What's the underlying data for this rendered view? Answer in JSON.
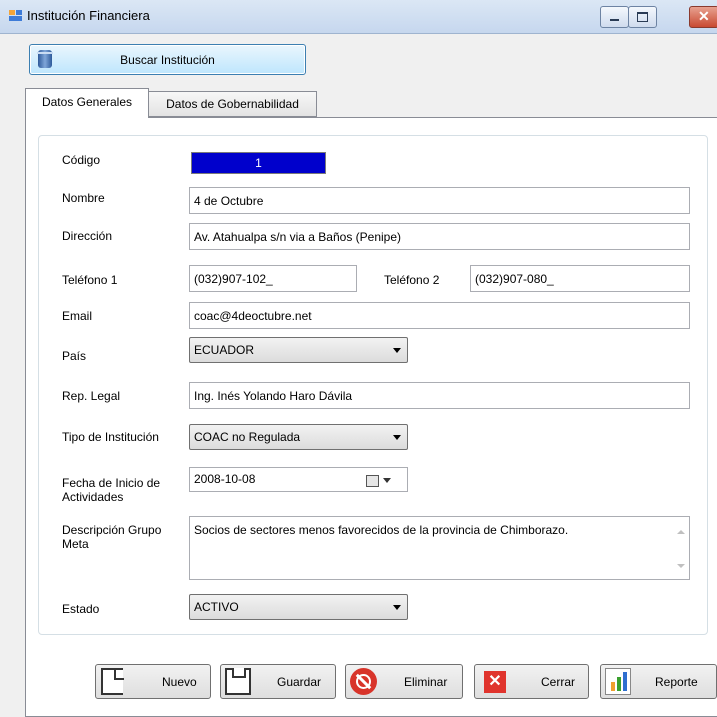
{
  "window": {
    "title": "Institución Financiera"
  },
  "toolbar": {
    "search_label": "Buscar Institución"
  },
  "tabs": [
    {
      "label": "Datos Generales",
      "selected": true
    },
    {
      "label": "Datos de Gobernabilidad",
      "selected": false
    }
  ],
  "form": {
    "codigo_label": "Código",
    "codigo_value": "1",
    "nombre_label": "Nombre",
    "nombre_value": "4 de Octubre",
    "direccion_label": "Dirección",
    "direccion_value": "Av. Atahualpa s/n via a Baños (Penipe)",
    "telefono1_label": "Teléfono 1",
    "telefono1_value": "(032)907-102_",
    "telefono2_label": "Teléfono 2",
    "telefono2_value": "(032)907-080_",
    "email_label": "Email",
    "email_value": "coac@4deoctubre.net",
    "pais_label": "País",
    "pais_value": "ECUADOR",
    "rep_label": "Rep. Legal",
    "rep_value": "Ing. Inés Yolando Haro Dávila",
    "tipo_label": "Tipo de Institución",
    "tipo_value": "COAC no Regulada",
    "fecha_label": "Fecha de Inicio de Actividades",
    "fecha_value": "2008-10-08",
    "desc_label": "Descripción Grupo Meta",
    "desc_value": "Socios de sectores menos favorecidos de la provincia de Chimborazo.",
    "estado_label": "Estado",
    "estado_value": "ACTIVO"
  },
  "actions": {
    "nuevo": "Nuevo",
    "guardar": "Guardar",
    "eliminar": "Eliminar",
    "cerrar": "Cerrar",
    "reporte": "Reporte"
  },
  "colors": {
    "code_bg": "#0000cc",
    "delete_red": "#d8342a",
    "close_red": "#e0342d",
    "report_green": "#3aa02e",
    "report_orange": "#f0a030",
    "report_blue": "#2f6fd0"
  }
}
